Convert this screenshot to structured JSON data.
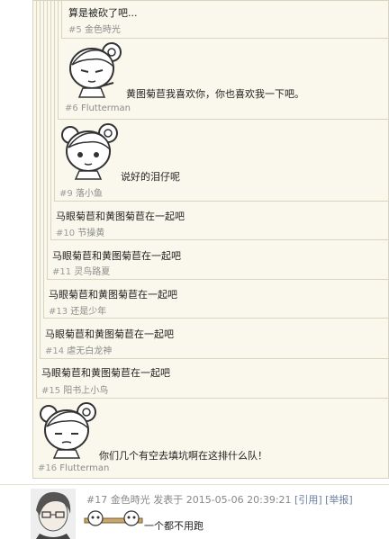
{
  "quotes": [
    {
      "text": "算是被砍了吧...",
      "num": "#5",
      "author": "金色時光"
    },
    {
      "text": "黄图菊苣我喜欢你，你也喜欢我一下吧。",
      "num": "#6",
      "author": "Flutterman"
    },
    {
      "text": "说好的泪仔呢",
      "num": "#9",
      "author": "落小鱼"
    },
    {
      "text": "马眼菊苣和黄图菊苣在一起吧",
      "num": "#10",
      "author": "节操黄"
    },
    {
      "text": "马眼菊苣和黄图菊苣在一起吧",
      "num": "#11",
      "author": "灵鸟路夏"
    },
    {
      "text": "马眼菊苣和黄图菊苣在一起吧",
      "num": "#13",
      "author": "还是少年"
    },
    {
      "text": "马眼菊苣和黄图菊苣在一起吧",
      "num": "#14",
      "author": "虐无白龙神"
    },
    {
      "text": "马眼菊苣和黄图菊苣在一起吧",
      "num": "#15",
      "author": "阳书上小鸟"
    },
    {
      "text": "你们几个有空去填坑啊在这排什么队！",
      "num": "#16",
      "author": "Flutterman"
    }
  ],
  "post": {
    "num": "#17",
    "author": "金色時光",
    "posted_label": "发表于",
    "datetime": "2015-05-06 20:39:21",
    "quote_link": "[引用]",
    "report_link": "[举报]",
    "content": "一个都不用跑"
  }
}
